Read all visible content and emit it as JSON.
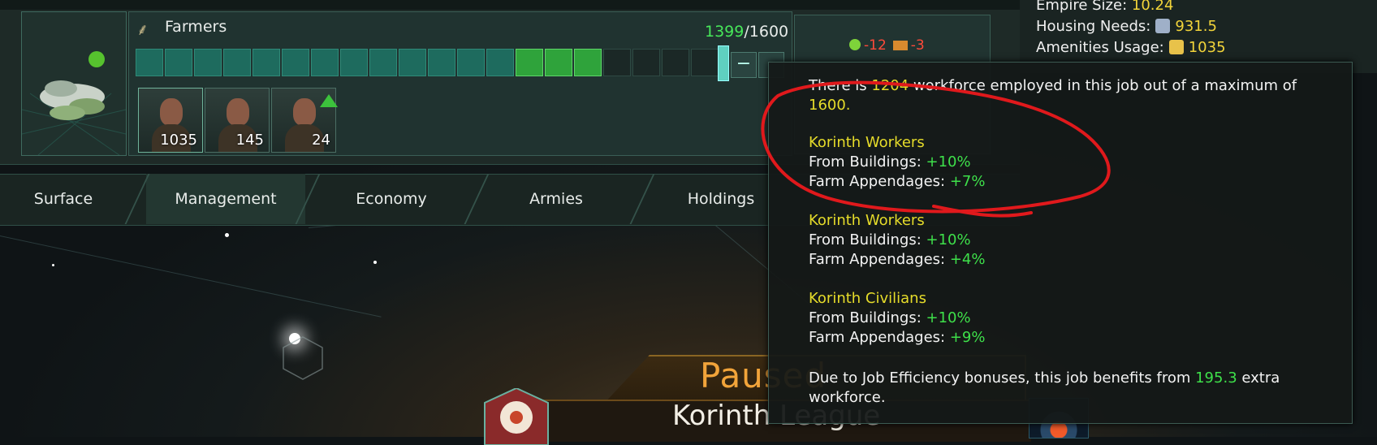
{
  "job": {
    "title": "Farmers",
    "employed_count": "1399",
    "max_count": "/1600",
    "pops": [
      {
        "count": "1035"
      },
      {
        "count": "145"
      },
      {
        "count": "24"
      }
    ],
    "output_food": "-12",
    "output_consumer": "-3",
    "bar": {
      "filled_teal": 13,
      "filled_green": 3,
      "empty": 4
    }
  },
  "empire": {
    "size_label": "Empire Size:",
    "size_value": "10.24",
    "housing_label": "Housing Needs:",
    "housing_value": "931.5",
    "amenities_label": "Amenities Usage:",
    "amenities_value": "1035"
  },
  "tabs": [
    {
      "label": "Surface"
    },
    {
      "label": "Management"
    },
    {
      "label": "Economy"
    },
    {
      "label": "Armies"
    },
    {
      "label": "Holdings"
    }
  ],
  "tooltip": {
    "intro_prefix": "There is ",
    "intro_value": "1204",
    "intro_suffix": " workforce employed in this job out of a maximum of",
    "intro_max": "1600.",
    "groups": [
      {
        "name": "Korinth Workers",
        "buildings_label": "From Buildings: ",
        "buildings_value": "+10%",
        "appendages_label": "Farm Appendages: ",
        "appendages_value": "+7%"
      },
      {
        "name": "Korinth Workers",
        "buildings_label": "From Buildings: ",
        "buildings_value": "+10%",
        "appendages_label": "Farm Appendages: ",
        "appendages_value": "+4%"
      },
      {
        "name": "Korinth Civilians",
        "buildings_label": "From Buildings: ",
        "buildings_value": "+10%",
        "appendages_label": "Farm Appendages: ",
        "appendages_value": "+9%"
      }
    ],
    "efficiency_prefix": "Due to Job Efficiency bonuses, this job benefits from ",
    "efficiency_value": "195.3",
    "efficiency_suffix": " extra",
    "efficiency_line2": "workforce."
  },
  "status": {
    "paused": "Paused",
    "empire_name": "Korinth League"
  },
  "annotation_color": "#e0191c"
}
